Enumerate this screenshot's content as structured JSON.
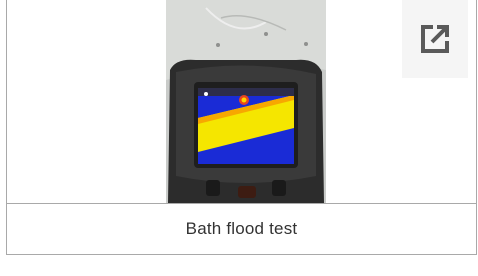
{
  "figure": {
    "caption": "Bath flood test",
    "image_subject": "thermal-camera-display",
    "open_icon": "external-link-icon"
  },
  "colors": {
    "border": "#a9a9a9",
    "caption_text": "#333333",
    "icon": "#5a5a5a",
    "thermal_blue": "#1a2bd6",
    "thermal_yellow": "#f5e600"
  }
}
